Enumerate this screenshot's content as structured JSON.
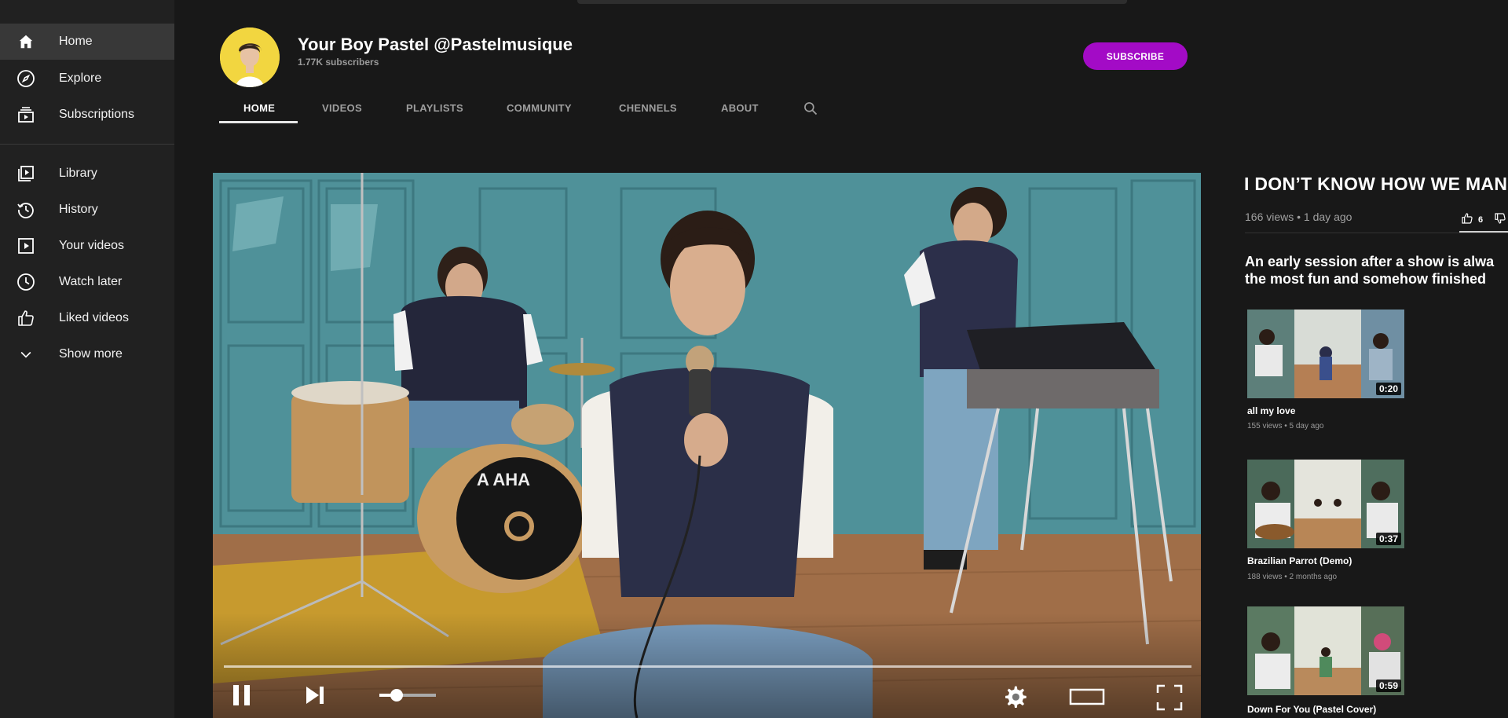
{
  "sidebar": {
    "items": [
      {
        "label": "Home",
        "icon": "home-icon",
        "active": true
      },
      {
        "label": "Explore",
        "icon": "compass-icon"
      },
      {
        "label": "Subscriptions",
        "icon": "subscriptions-icon"
      },
      {
        "label": "Library",
        "icon": "library-icon"
      },
      {
        "label": "History",
        "icon": "history-icon"
      },
      {
        "label": "Your videos",
        "icon": "your-videos-icon"
      },
      {
        "label": "Watch later",
        "icon": "clock-icon"
      },
      {
        "label": "Liked videos",
        "icon": "thumbs-up-icon"
      },
      {
        "label": "Show more",
        "icon": "chevron-down-icon"
      }
    ]
  },
  "channel": {
    "name": "Your Boy Pastel @Pastelmusique",
    "subscribers": "1.77K subscribers",
    "subscribe_label": "SUBSCRIBE",
    "subscribe_color": "#a30bc6"
  },
  "tabs": [
    "HOME",
    "VIDEOS",
    "PLAYLISTS",
    "COMMUNITY",
    "CHENNELS",
    "ABOUT"
  ],
  "featured": {
    "title": "I DON’T KNOW HOW WE MAN",
    "meta": "166 views • 1 day ago",
    "likes": "6",
    "description_line1": "An early session after a show is alwa",
    "description_line2": "the most fun and somehow finished",
    "drum_logo": "A AHA",
    "player_icons": [
      "pause-icon",
      "next-icon",
      "volume-icon",
      "settings-icon",
      "theater-icon",
      "fullscreen-icon"
    ]
  },
  "recommendations": [
    {
      "title": "all my love",
      "meta": "155 views • 5 day ago",
      "duration": "0:20"
    },
    {
      "title": "Brazilian Parrot (Demo)",
      "meta": "188 views • 2 months ago",
      "duration": "0:37"
    },
    {
      "title": "Down For You (Pastel Cover)",
      "meta": "",
      "duration": "0:59"
    }
  ]
}
